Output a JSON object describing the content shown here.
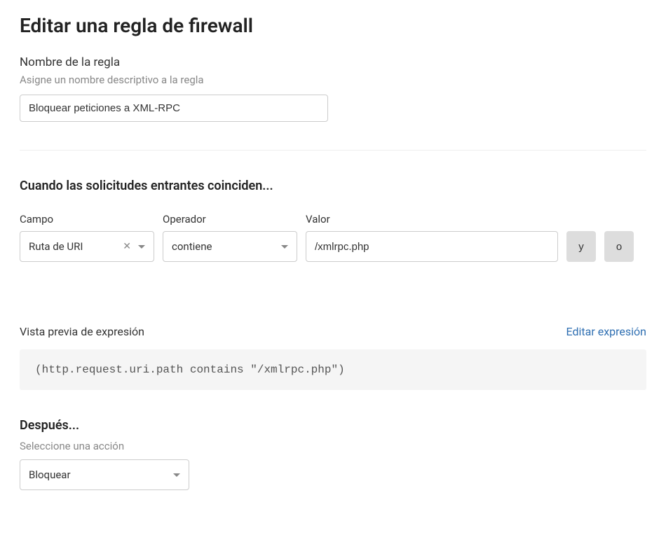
{
  "page": {
    "title": "Editar una regla de firewall"
  },
  "rule_name": {
    "label": "Nombre de la regla",
    "help": "Asigne un nombre descriptivo a la regla",
    "value": "Bloquear peticiones a XML-RPC"
  },
  "match": {
    "heading": "Cuando las solicitudes entrantes coinciden...",
    "field_label": "Campo",
    "operator_label": "Operador",
    "value_label": "Valor",
    "field_value": "Ruta de URI",
    "operator_value": "contiene",
    "value_value": "/xmlrpc.php",
    "and_label": "y",
    "or_label": "o"
  },
  "preview": {
    "label": "Vista previa de expresión",
    "edit_link": "Editar expresión",
    "expression": "(http.request.uri.path contains \"/xmlrpc.php\")"
  },
  "after": {
    "heading": "Después...",
    "label": "Seleccione una acción",
    "action_value": "Bloquear"
  }
}
